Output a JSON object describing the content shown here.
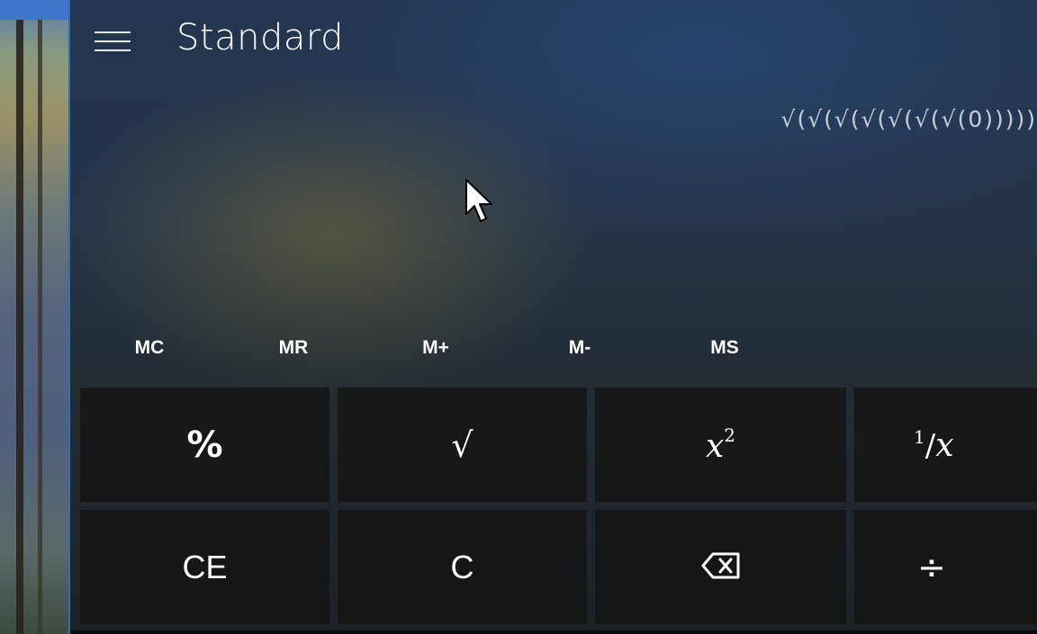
{
  "header": {
    "menu_icon": "hamburger-menu-icon",
    "mode_title": "Standard"
  },
  "display": {
    "expression": "√(√(√(√(√(√(√(0)))))"
  },
  "memory": {
    "mc": "MC",
    "mr": "MR",
    "m_plus": "M+",
    "m_minus": "M-",
    "ms": "MS"
  },
  "keys": {
    "percent": "%",
    "sqrt": "√",
    "square_base": "x",
    "square_exp": "2",
    "reciprocal_num": "1",
    "reciprocal_den": "x",
    "clear_entry": "CE",
    "clear": "C",
    "backspace_icon": "backspace-icon",
    "divide": "÷"
  },
  "colors": {
    "accent_border": "#2f6fb3",
    "key_background": "#141414",
    "text": "#ffffff"
  }
}
